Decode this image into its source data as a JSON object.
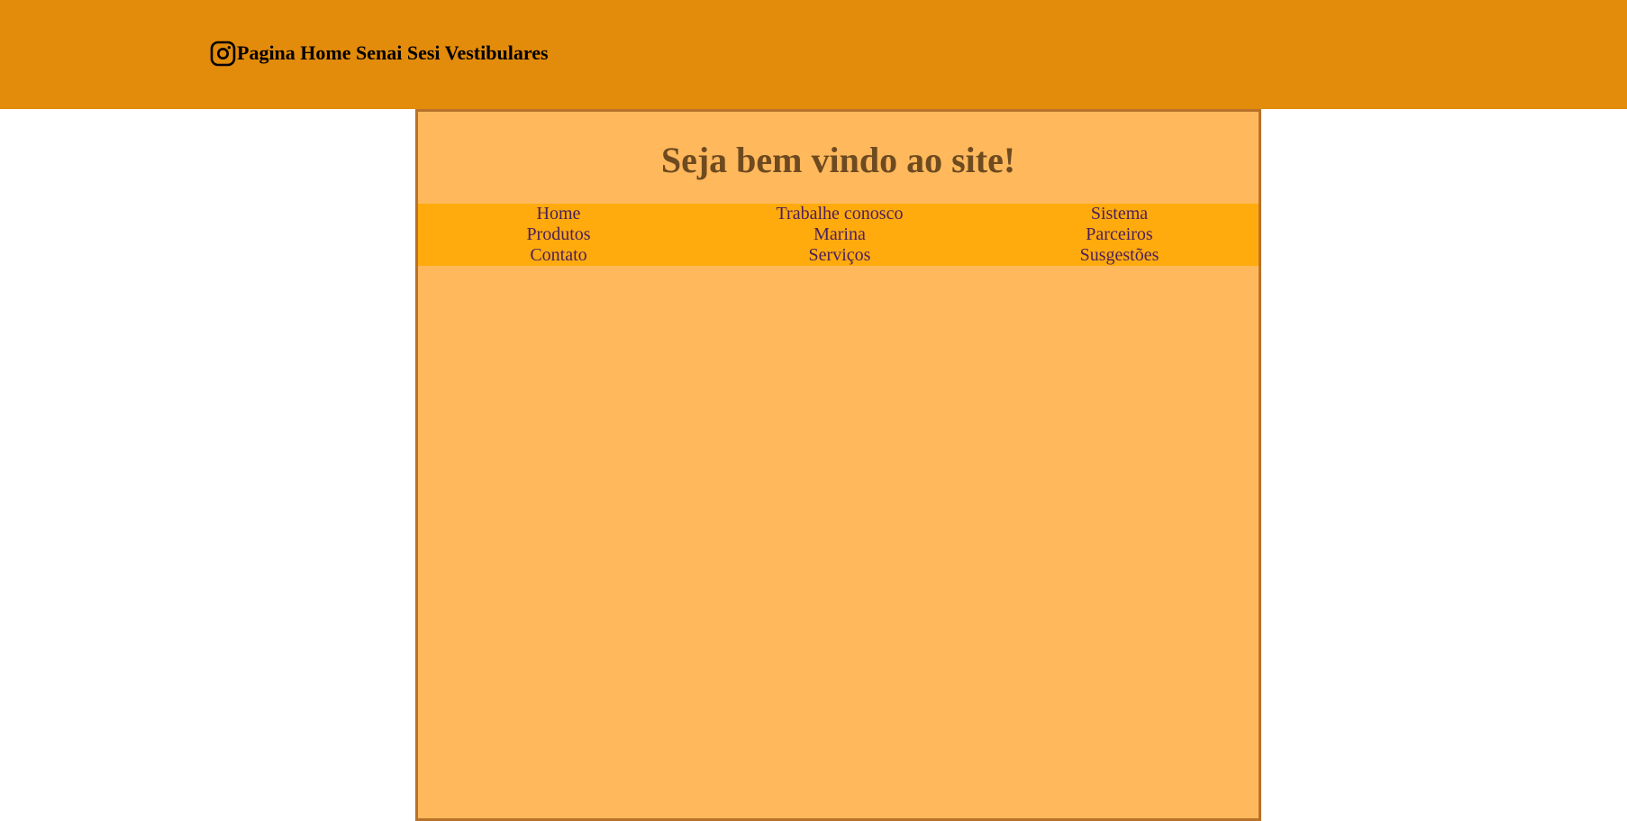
{
  "header": {
    "brand_icon": "instagram-icon",
    "brand_text": "Pagina Home Senai Sesi Vestibulares",
    "background": "#e38b0a"
  },
  "main": {
    "welcome_title": "Seja bem vindo ao site!",
    "background": "#ffb95c",
    "border_color": "#b8722a"
  },
  "nav": {
    "background": "#ffaa0d",
    "link_color": "#4a1f5a",
    "items": [
      {
        "label": "Home"
      },
      {
        "label": "Trabalhe conosco"
      },
      {
        "label": "Sistema"
      },
      {
        "label": "Produtos"
      },
      {
        "label": "Marina"
      },
      {
        "label": "Parceiros"
      },
      {
        "label": "Contato"
      },
      {
        "label": "Serviços"
      },
      {
        "label": "Susgestões"
      }
    ]
  }
}
